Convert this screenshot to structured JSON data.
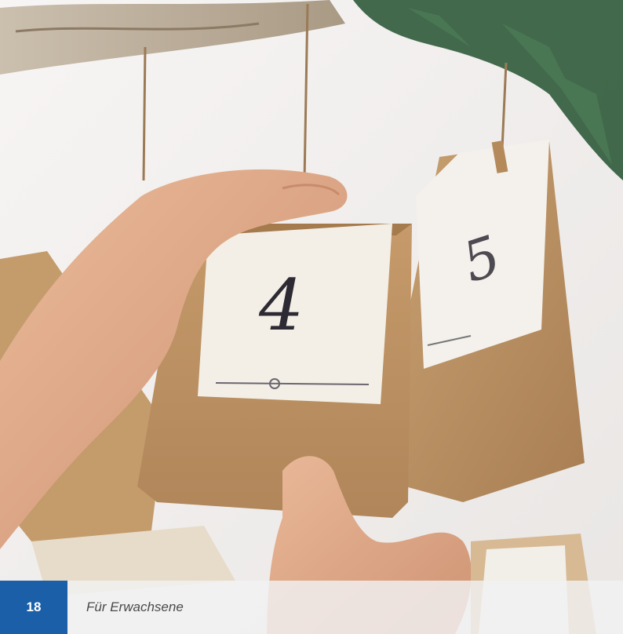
{
  "photo": {
    "description_icon": "advent-calendar-paper-bags-photo",
    "tag_numbers": [
      "4",
      "5"
    ]
  },
  "footer": {
    "page_number": "18",
    "section_title": "Für Erwachsene",
    "badge_color": "#1b5fa8"
  }
}
